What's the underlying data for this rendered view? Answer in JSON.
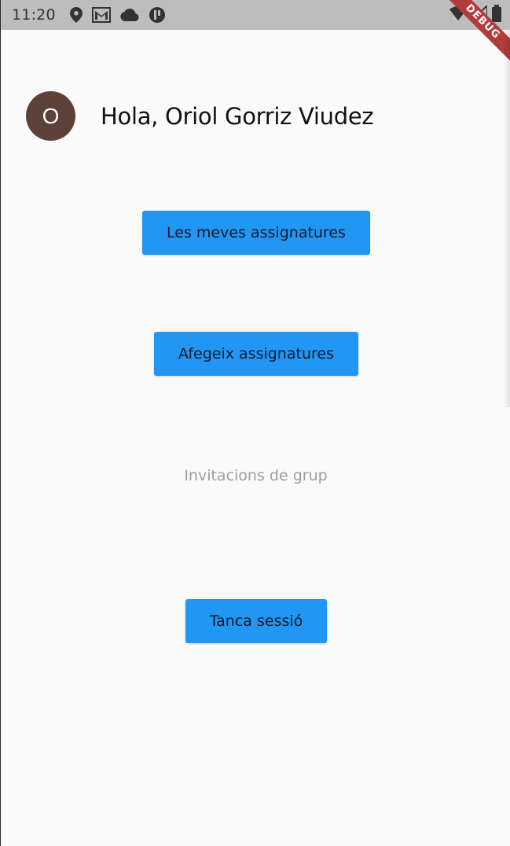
{
  "status_bar": {
    "time": "11:20",
    "left_icons": [
      "location-pin-icon",
      "gmail-icon",
      "cloud-icon",
      "app-notification-icon"
    ],
    "right_icons": [
      "wifi-icon",
      "signal-icon",
      "battery-icon"
    ]
  },
  "debug_banner": {
    "label": "DEBUG"
  },
  "header": {
    "avatar_initial": "O",
    "avatar_color": "#5d4037",
    "greeting": "Hola, Oriol Gorriz Viudez"
  },
  "actions": {
    "my_subjects": "Les meves assignatures",
    "add_subjects": "Afegeix assignatures",
    "group_invitations": "Invitacions de grup",
    "logout": "Tanca sessió"
  },
  "colors": {
    "accent": "#2196f3",
    "background": "#fafafa",
    "status_bar": "#bdbdbd",
    "disabled_text": "#9e9e9e"
  }
}
